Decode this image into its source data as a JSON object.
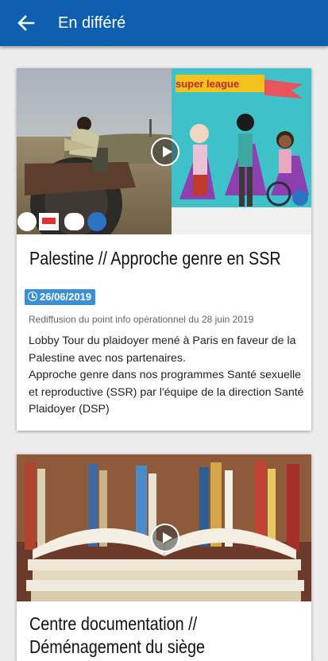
{
  "header": {
    "title": "En différé",
    "back_icon": "arrow-left-icon"
  },
  "colors": {
    "appbar": "#0f5fb0",
    "badge": "#3d8fd3",
    "background": "#ececec"
  },
  "cards": [
    {
      "title": "Palestine // Approche genre en SSR",
      "date": "26/06/2019",
      "subtitle": "Rediffusion du point info opérationnel du 28 juin 2019",
      "description": [
        "Lobby Tour du plaidoyer mené à Paris en faveur de la Palestine avec nos partenaires.",
        "Approche genre dans nos programmes Santé sexuelle et reproductive (SSR)  par l'équipe de la direction Santé Plaidoyer (DSP)"
      ],
      "thumbnail_banner": "super league"
    },
    {
      "title_line1": "Centre documentation //",
      "title_line2": "Déménagement du siège"
    }
  ]
}
